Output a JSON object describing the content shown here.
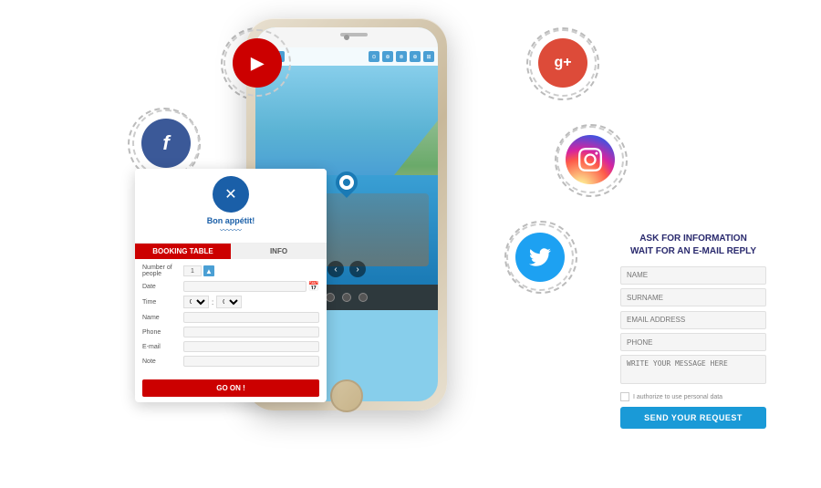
{
  "page": {
    "background": "#ffffff"
  },
  "social_icons": {
    "youtube": {
      "label": "▶",
      "bg": "#cc0000"
    },
    "facebook": {
      "label": "f",
      "bg": "#3b5998"
    },
    "google_plus": {
      "label": "g+",
      "bg": "#dd4b39"
    },
    "instagram": {
      "label": "📷",
      "bg": "instagram-gradient"
    },
    "twitter": {
      "label": "🐦",
      "bg": "#1da1f2"
    }
  },
  "booking_panel": {
    "logo_text": "Bon appétit!",
    "tab_booking": "BOOKING TABLE",
    "tab_info": "INFO",
    "fields": {
      "number_of_people_label": "Number of people",
      "number_of_people_value": "1",
      "date_label": "Date",
      "time_label": "Time",
      "name_label": "Name",
      "phone_label": "Phone",
      "email_label": "E-mail",
      "note_label": "Note"
    },
    "go_button": "GO ON !"
  },
  "info_panel": {
    "title_line1": "ASK FOR INFORMATION",
    "title_line2": "WAIT FOR AN E-MAIL REPLY",
    "fields": {
      "name_placeholder": "NAME",
      "surname_placeholder": "SURNAME",
      "email_placeholder": "EMAIL ADDRESS",
      "phone_placeholder": "PHONE",
      "message_placeholder": "WRITE YOUR MESSAGE HERE"
    },
    "checkbox_label": "I authorize to use personal data",
    "submit_button": "SEND YOUR REQUEST"
  }
}
